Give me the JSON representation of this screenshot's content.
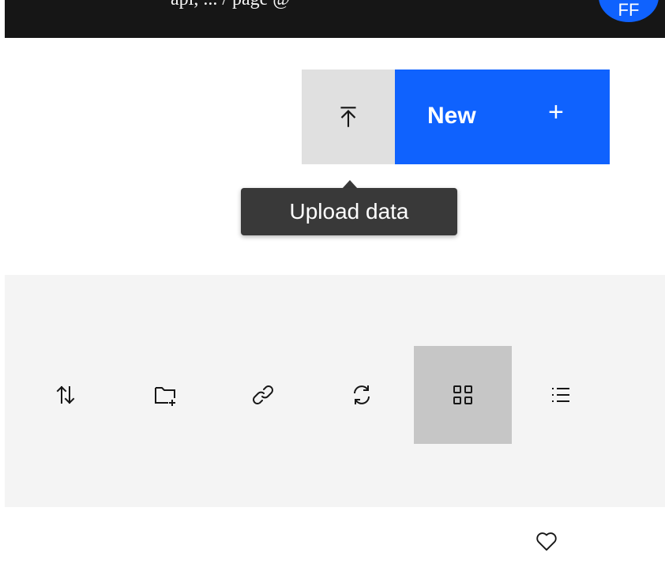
{
  "header": {
    "partial_text": "api, ... / page @ ",
    "avatar_initials": "FF"
  },
  "actions": {
    "upload_icon": "upload-icon",
    "new_label": "New",
    "new_icon": "+",
    "tooltip": "Upload data"
  },
  "toolbar": {
    "buttons": [
      {
        "icon": "sort-icon",
        "active": false
      },
      {
        "icon": "new-folder-icon",
        "active": false
      },
      {
        "icon": "link-icon",
        "active": false
      },
      {
        "icon": "refresh-icon",
        "active": false
      },
      {
        "icon": "grid-view-icon",
        "active": true
      },
      {
        "icon": "list-view-icon",
        "active": false
      }
    ]
  },
  "card": {
    "favorite_icon": "heart-icon"
  },
  "colors": {
    "topbar": "#161616",
    "primary": "#0f62fe",
    "upload_bg": "#e0e0e0",
    "tooltip_bg": "#393939",
    "toolbar_bg": "#f4f4f4",
    "active_tool_bg": "#c6c6c6"
  }
}
